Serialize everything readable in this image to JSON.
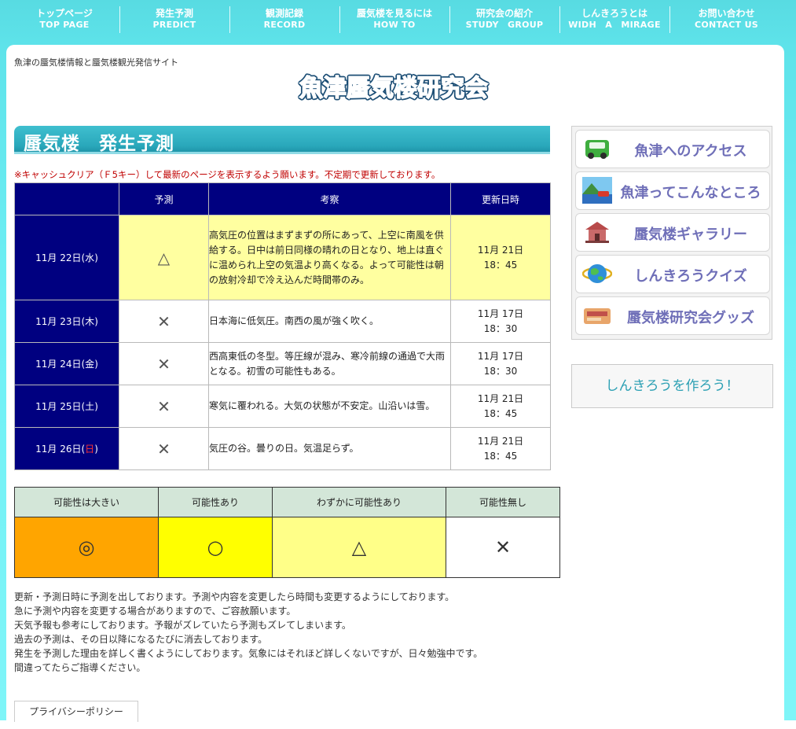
{
  "nav": [
    {
      "jp": "トップページ",
      "en": "TOP PAGE"
    },
    {
      "jp": "発生予測",
      "en": "PREDICT"
    },
    {
      "jp": "観測記録",
      "en": "RECORD"
    },
    {
      "jp": "蜃気楼を見るには",
      "en": "HOW TO"
    },
    {
      "jp": "研究会の紹介",
      "en": "STUDY　GROUP"
    },
    {
      "jp": "しんきろうとは",
      "en": "WIDH　A　MIRAGE"
    },
    {
      "jp": "お問い合わせ",
      "en": "CONTACT US"
    }
  ],
  "header": {
    "tagline": "魚津の蜃気楼情報と蜃気楼観光発信サイト",
    "logo_text": "魚津蜃気楼研究会"
  },
  "page_title": "蜃気楼　発生予測",
  "notice": "※キャッシュクリア（Ｆ5キー）して最新のページを表示するよう願います。不定期で更新しております。",
  "forecast": {
    "headers": [
      "",
      "予測",
      "考察",
      "更新日時"
    ],
    "rows": [
      {
        "date_pre": "11月 22日(",
        "dow": "水",
        "date_post": ")",
        "symbol": "△",
        "note": "高気圧の位置はまずまずの所にあって、上空に南風を供給する。日中は前日同様の晴れの日となり、地上は直ぐに温められ上空の気温より高くなる。よって可能性は朝の放射冷却で冷え込んだ時間帯のみ。",
        "upd_date": "11月 21日",
        "upd_time": "18：45"
      },
      {
        "date_pre": "11月 23日(",
        "dow": "木",
        "date_post": ")",
        "symbol": "✕",
        "note": "日本海に低気圧。南西の風が強く吹く。",
        "upd_date": "11月 17日",
        "upd_time": "18：30"
      },
      {
        "date_pre": "11月 24日(",
        "dow": "金",
        "date_post": ")",
        "symbol": "✕",
        "note": "西高東低の冬型。等圧線が混み、寒冷前線の通過で大雨となる。初雪の可能性もある。",
        "upd_date": "11月 17日",
        "upd_time": "18：30"
      },
      {
        "date_pre": "11月 25日(",
        "dow": "土",
        "date_post": ")",
        "symbol": "✕",
        "note": "寒気に覆われる。大気の状態が不安定。山沿いは雪。",
        "upd_date": "11月 21日",
        "upd_time": "18：45"
      },
      {
        "date_pre": "11月 26日(",
        "dow": "日",
        "date_post": ")",
        "symbol": "✕",
        "note": "気圧の谷。曇りの日。気温足らず。",
        "upd_date": "11月 21日",
        "upd_time": "18：45"
      }
    ]
  },
  "legend": [
    {
      "label": "可能性は大きい",
      "symbol": "◎",
      "color": "#ffa500"
    },
    {
      "label": "可能性あり",
      "symbol": "○",
      "color": "#ffff00"
    },
    {
      "label": "わずかに可能性あり",
      "symbol": "△",
      "color": "#ffff88"
    },
    {
      "label": "可能性無し",
      "symbol": "✕",
      "color": "#ffffff"
    }
  ],
  "info_lines": [
    "更新・予測日時に予測を出しております。予測や内容を変更したら時間も変更するようにしております。",
    "急に予測や内容を変更する場合がありますので、ご容赦願います。",
    "天気予報も参考にしております。予報がズレていたら予測もズレてしまいます。",
    "過去の予測は、その日以降になるたびに消去しております。",
    "発生を予測した理由を詳しく書くようにしております。気象にはそれほど詳しくないですが、日々勉強中です。",
    "間違ってたらご指導ください。"
  ],
  "privacy": "プライバシーポリシー",
  "sidebar": [
    {
      "label": "魚津へのアクセス",
      "icon": "car-icon"
    },
    {
      "label": "魚津ってこんなところ",
      "icon": "landscape-icon"
    },
    {
      "label": "蜃気楼ギャラリー",
      "icon": "gallery-icon"
    },
    {
      "label": "しんきろうクイズ",
      "icon": "globe-icon"
    },
    {
      "label": "蜃気楼研究会グッズ",
      "icon": "goods-icon"
    }
  ],
  "make_button": "しんきろうを作ろう！",
  "colors": {
    "accent": "#2aa8bb",
    "nav_bg": "#58dbe2",
    "table_header": "#000080",
    "highlight_row": "#ffffa0",
    "notice": "#c00000"
  }
}
